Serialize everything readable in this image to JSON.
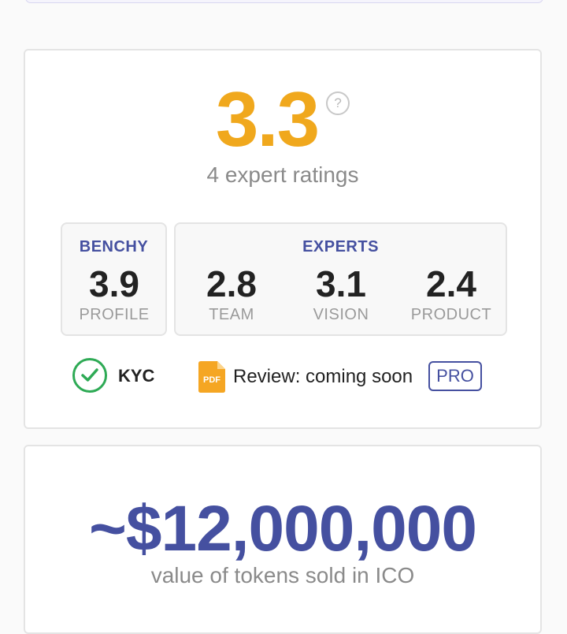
{
  "rating": {
    "score": "3.3",
    "help_icon": "?",
    "count_text": "4 expert ratings"
  },
  "benchy": {
    "heading": "BENCHY",
    "value": "3.9",
    "label": "PROFILE"
  },
  "experts": {
    "heading": "EXPERTS",
    "metrics": [
      {
        "value": "2.8",
        "label": "TEAM"
      },
      {
        "value": "3.1",
        "label": "VISION"
      },
      {
        "value": "2.4",
        "label": "PRODUCT"
      }
    ]
  },
  "kyc": {
    "icon": "check-circle-icon",
    "label": "KYC"
  },
  "review": {
    "icon": "pdf-icon",
    "pdf_text": "PDF",
    "text": "Review: coming soon",
    "pro_label": "PRO"
  },
  "ico": {
    "value": "~$12,000,000",
    "caption": "value of tokens sold in ICO"
  },
  "colors": {
    "score": "#f0a81d",
    "accent": "#4550a0",
    "kyc_green": "#2eaa55",
    "pdf_orange": "#f5a623"
  }
}
